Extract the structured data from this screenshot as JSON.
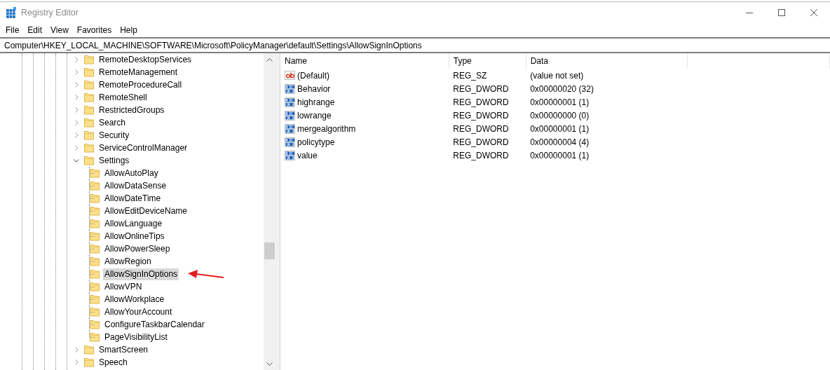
{
  "window": {
    "title": "Registry Editor"
  },
  "menu": [
    "File",
    "Edit",
    "View",
    "Favorites",
    "Help"
  ],
  "address": {
    "value": "Computer\\HKEY_LOCAL_MACHINE\\SOFTWARE\\Microsoft\\PolicyManager\\default\\Settings\\AllowSignInOptions"
  },
  "tree": {
    "items": [
      {
        "label": "RemoteDesktopServices",
        "expanded": false,
        "selected": false
      },
      {
        "label": "RemoteManagement",
        "expanded": false,
        "selected": false
      },
      {
        "label": "RemoteProcedureCall",
        "expanded": false,
        "selected": false
      },
      {
        "label": "RemoteShell",
        "expanded": false,
        "selected": false
      },
      {
        "label": "RestrictedGroups",
        "expanded": false,
        "selected": false
      },
      {
        "label": "Search",
        "expanded": false,
        "selected": false
      },
      {
        "label": "Security",
        "expanded": false,
        "selected": false
      },
      {
        "label": "ServiceControlManager",
        "expanded": false,
        "selected": false
      },
      {
        "label": "Settings",
        "expanded": true,
        "selected": false,
        "children": [
          {
            "label": "AllowAutoPlay",
            "selected": false
          },
          {
            "label": "AllowDataSense",
            "selected": false
          },
          {
            "label": "AllowDateTime",
            "selected": false
          },
          {
            "label": "AllowEditDeviceName",
            "selected": false
          },
          {
            "label": "AllowLanguage",
            "selected": false
          },
          {
            "label": "AllowOnlineTips",
            "selected": false
          },
          {
            "label": "AllowPowerSleep",
            "selected": false
          },
          {
            "label": "AllowRegion",
            "selected": false
          },
          {
            "label": "AllowSignInOptions",
            "selected": true
          },
          {
            "label": "AllowVPN",
            "selected": false
          },
          {
            "label": "AllowWorkplace",
            "selected": false
          },
          {
            "label": "AllowYourAccount",
            "selected": false
          },
          {
            "label": "ConfigureTaskbarCalendar",
            "selected": false
          },
          {
            "label": "PageVisibilityList",
            "selected": false
          }
        ]
      },
      {
        "label": "SmartScreen",
        "expanded": false,
        "selected": false
      },
      {
        "label": "Speech",
        "expanded": false,
        "selected": false
      }
    ]
  },
  "values": {
    "columns": [
      "Name",
      "Type",
      "Data"
    ],
    "rows": [
      {
        "kind": "string",
        "name": "(Default)",
        "type": "REG_SZ",
        "data": "(value not set)"
      },
      {
        "kind": "dword",
        "name": "Behavior",
        "type": "REG_DWORD",
        "data": "0x00000020 (32)"
      },
      {
        "kind": "dword",
        "name": "highrange",
        "type": "REG_DWORD",
        "data": "0x00000001 (1)"
      },
      {
        "kind": "dword",
        "name": "lowrange",
        "type": "REG_DWORD",
        "data": "0x00000000 (0)"
      },
      {
        "kind": "dword",
        "name": "mergealgorithm",
        "type": "REG_DWORD",
        "data": "0x00000001 (1)"
      },
      {
        "kind": "dword",
        "name": "policytype",
        "type": "REG_DWORD",
        "data": "0x00000004 (4)"
      },
      {
        "kind": "dword",
        "name": "value",
        "type": "REG_DWORD",
        "data": "0x00000001 (1)"
      }
    ]
  }
}
